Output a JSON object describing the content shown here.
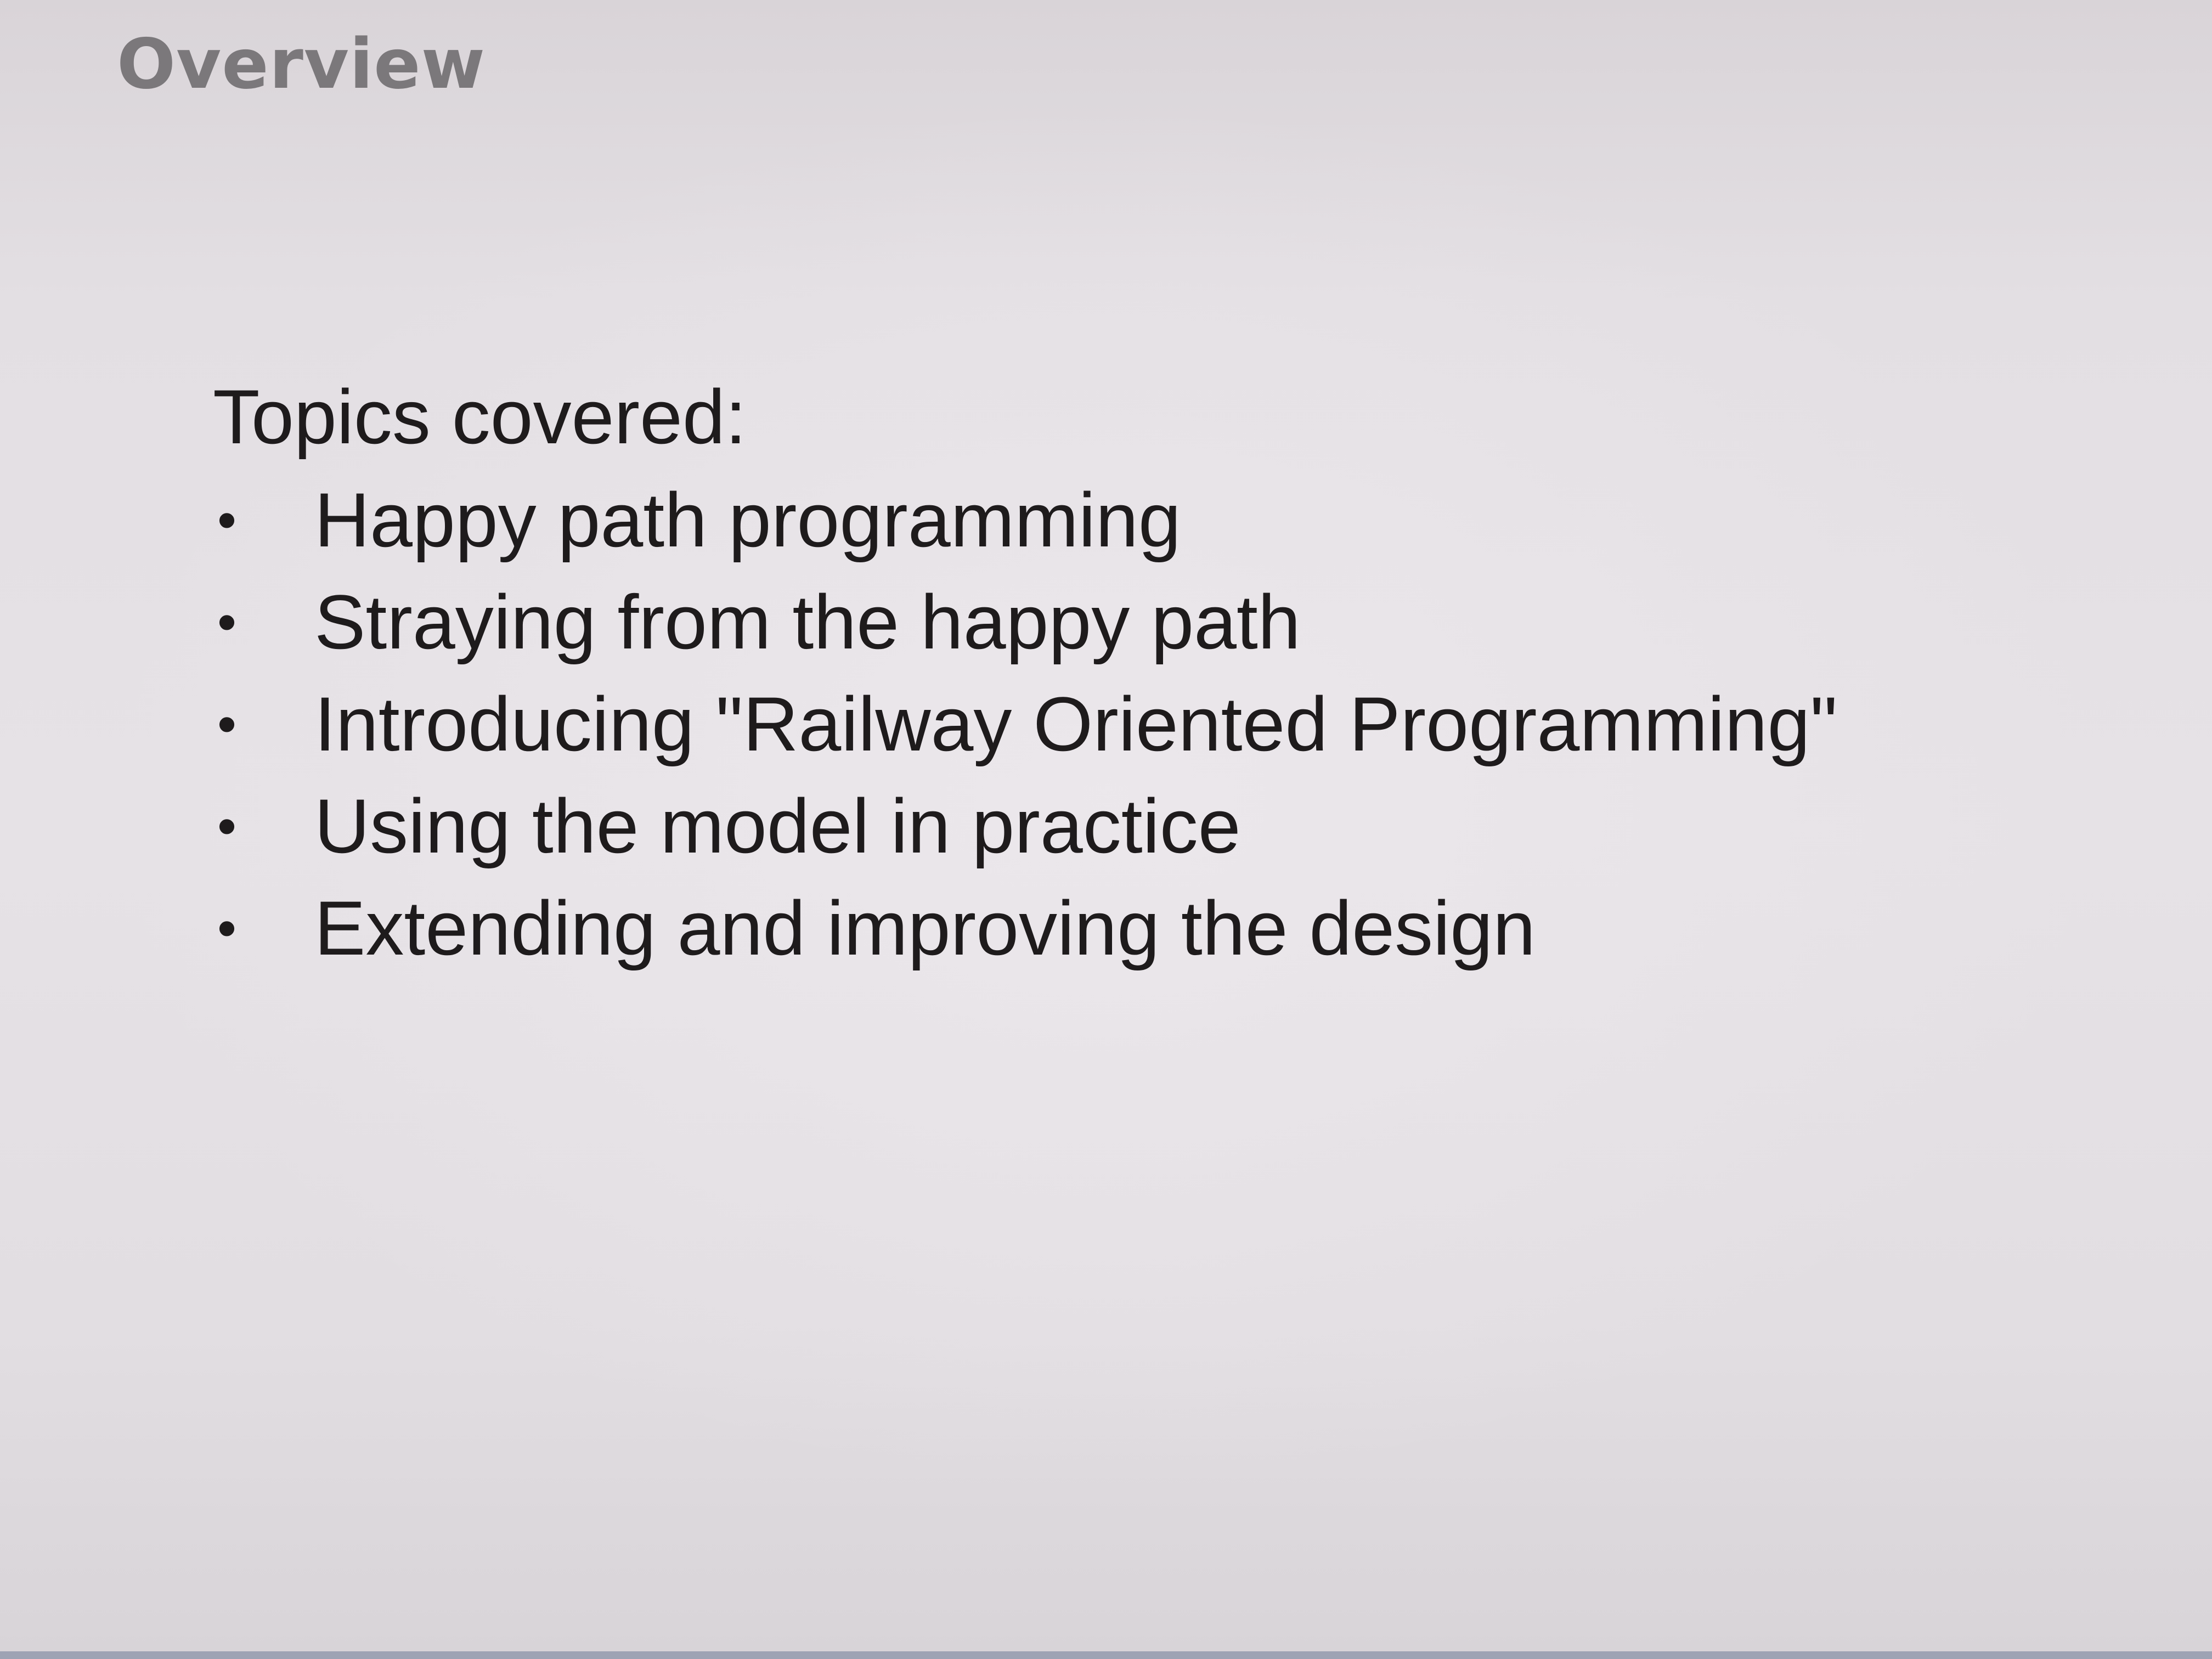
{
  "slide": {
    "title": "Overview",
    "heading": "Topics covered:",
    "bullet_glyph": "•",
    "topics": [
      "Happy path programming",
      "Straying from the happy path",
      "Introducing \"Railway Oriented Programming\"",
      "Using the model in practice",
      "Extending and improving the design"
    ]
  }
}
